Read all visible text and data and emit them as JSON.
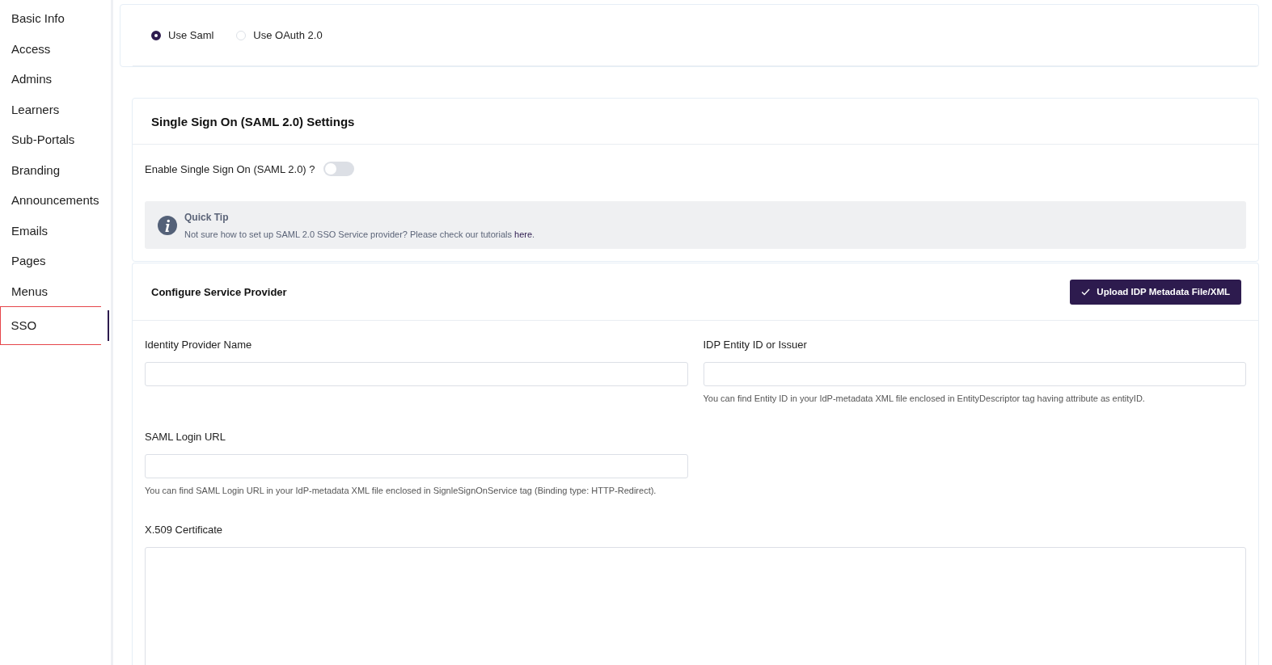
{
  "sidebar": {
    "items": [
      {
        "label": "Basic Info",
        "selected": false
      },
      {
        "label": "Access",
        "selected": false
      },
      {
        "label": "Admins",
        "selected": false
      },
      {
        "label": "Learners",
        "selected": false
      },
      {
        "label": "Sub-Portals",
        "selected": false
      },
      {
        "label": "Branding",
        "selected": false
      },
      {
        "label": "Announcements",
        "selected": false
      },
      {
        "label": "Emails",
        "selected": false
      },
      {
        "label": "Pages",
        "selected": false
      },
      {
        "label": "Menus",
        "selected": false
      },
      {
        "label": "SSO",
        "selected": true
      }
    ]
  },
  "auth_method": {
    "options": [
      {
        "label": "Use Saml",
        "selected": true
      },
      {
        "label": "Use OAuth 2.0",
        "selected": false
      }
    ]
  },
  "saml_settings": {
    "title": "Single Sign On (SAML 2.0) Settings",
    "enable": {
      "label": "Enable Single Sign On (SAML 2.0) ?",
      "on": false
    },
    "tip": {
      "title": "Quick Tip",
      "text": "Not sure how to set up SAML 2.0 SSO Service provider? Please check our tutorials ",
      "link": "here",
      "text_end": "."
    }
  },
  "service_provider": {
    "title": "Configure Service Provider",
    "upload_button": "Upload IDP Metadata File/XML",
    "fields": [
      {
        "label": "Identity Provider Name"
      },
      {
        "label": "IDP Entity ID or Issuer",
        "help": "You can find Entity ID in your IdP-metadata XML file enclosed in EntityDescriptor tag having attribute as entityID."
      },
      {
        "label": "SAML Login URL",
        "help": "You can find SAML Login URL in your IdP-metadata XML file enclosed in SignleSignOnService tag (Binding type: HTTP-Redirect)."
      }
    ],
    "certificate": {
      "label": "X.509 Certificate"
    }
  }
}
